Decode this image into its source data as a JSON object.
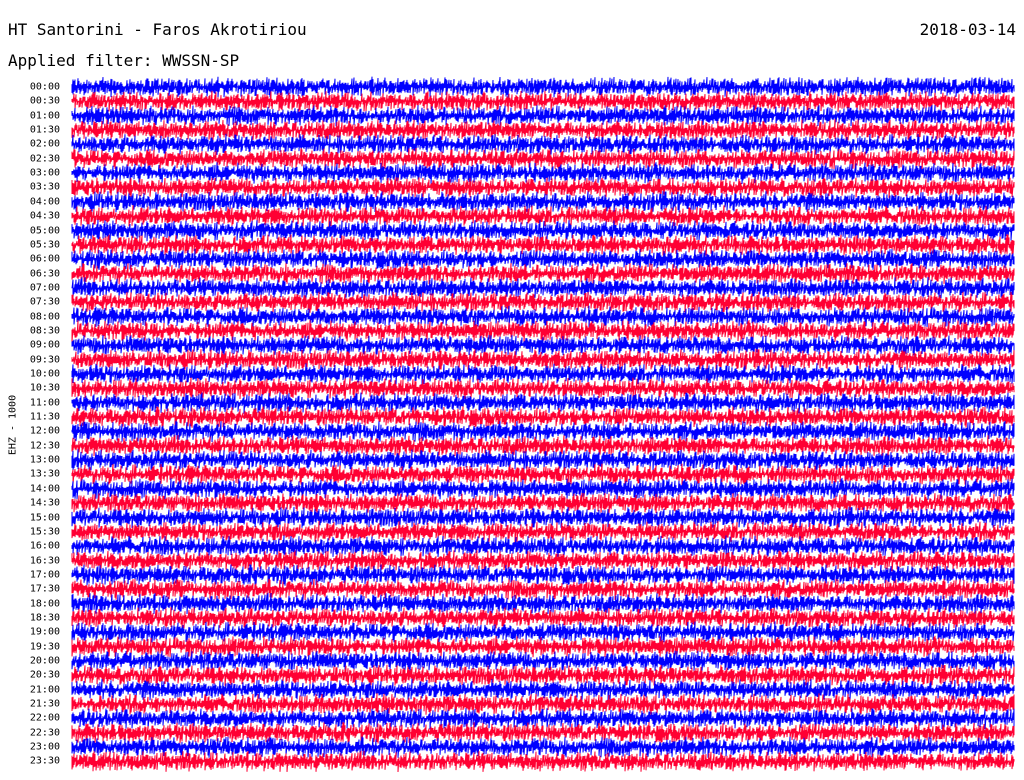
{
  "header": {
    "title": "HT Santorini - Faros Akrotiriou",
    "date": "2018-03-14",
    "filter": "Applied filter: WWSSN-SP"
  },
  "chart_data": {
    "type": "line",
    "ylabel": "EHZ - 1000",
    "row_labels": [
      "00:00",
      "00:30",
      "01:00",
      "01:30",
      "02:00",
      "02:30",
      "03:00",
      "03:30",
      "04:00",
      "04:30",
      "05:00",
      "05:30",
      "06:00",
      "06:30",
      "07:00",
      "07:30",
      "08:00",
      "08:30",
      "09:00",
      "09:30",
      "10:00",
      "10:30",
      "11:00",
      "11:30",
      "12:00",
      "12:30",
      "13:00",
      "13:30",
      "14:00",
      "14:30",
      "15:00",
      "15:30",
      "16:00",
      "16:30",
      "17:00",
      "17:30",
      "18:00",
      "18:30",
      "19:00",
      "19:30",
      "20:00",
      "20:30",
      "21:00",
      "21:30",
      "22:00",
      "22:30",
      "23:00",
      "23:30"
    ],
    "series_colors": [
      "#0000ff",
      "#ff0033"
    ],
    "grid": false
  }
}
